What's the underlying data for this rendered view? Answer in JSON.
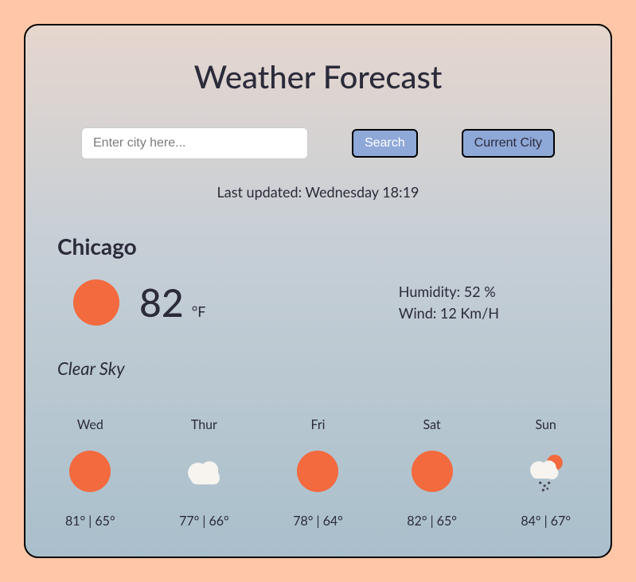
{
  "header": {
    "title": "Weather Forecast"
  },
  "search": {
    "placeholder": "Enter city here...",
    "search_button": "Search",
    "current_button": "Current City"
  },
  "last_updated": "Last updated: Wednesday 18:19",
  "current": {
    "city": "Chicago",
    "temp": "82",
    "unit": "°F",
    "humidity_label": "Humidity: ",
    "humidity_value": "52 %",
    "wind_label": "Wind: ",
    "wind_value": "12 Km/H",
    "description": "Clear Sky",
    "icon": "sun"
  },
  "forecast": [
    {
      "day": "Wed",
      "icon": "sun",
      "range": "81° | 65°"
    },
    {
      "day": "Thur",
      "icon": "cloud",
      "range": "77° | 66°"
    },
    {
      "day": "Fri",
      "icon": "sun",
      "range": "78° | 64°"
    },
    {
      "day": "Sat",
      "icon": "sun",
      "range": "82° | 65°"
    },
    {
      "day": "Sun",
      "icon": "rain-sun",
      "range": "84° | 67°"
    }
  ]
}
